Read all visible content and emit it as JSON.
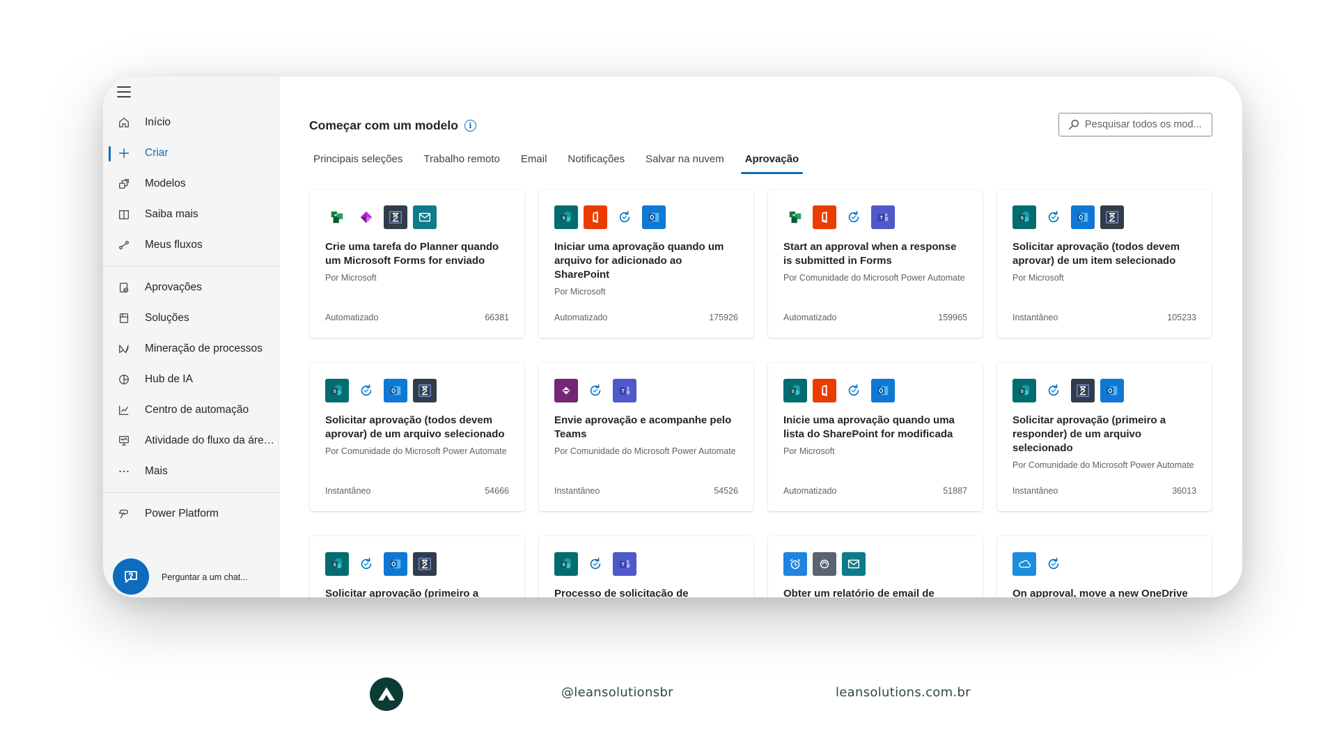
{
  "sidebar": {
    "items": [
      {
        "label": "Início",
        "icon": "home-icon"
      },
      {
        "label": "Criar",
        "icon": "plus-icon",
        "active": true
      },
      {
        "label": "Modelos",
        "icon": "templates-icon"
      },
      {
        "label": "Saiba mais",
        "icon": "book-icon"
      },
      {
        "label": "Meus fluxos",
        "icon": "flows-icon"
      },
      {
        "label": "Aprovações",
        "icon": "approvals-icon"
      },
      {
        "label": "Soluções",
        "icon": "solutions-icon"
      },
      {
        "label": "Mineração de processos",
        "icon": "process-mining-icon"
      },
      {
        "label": "Hub de IA",
        "icon": "ai-hub-icon"
      },
      {
        "label": "Centro de automação",
        "icon": "automation-center-icon"
      },
      {
        "label": "Atividade do fluxo da área...",
        "icon": "desktop-flow-activity-icon"
      },
      {
        "label": "Mais",
        "icon": "more-icon"
      },
      {
        "label": "Power Platform",
        "icon": "power-platform-icon"
      }
    ],
    "chat_label": "Perguntar a um chat..."
  },
  "main": {
    "title": "Começar com um modelo",
    "search_placeholder": "Pesquisar todos os mod...",
    "tabs": [
      {
        "label": "Principais seleções"
      },
      {
        "label": "Trabalho remoto"
      },
      {
        "label": "Email"
      },
      {
        "label": "Notificações"
      },
      {
        "label": "Salvar na nuvem"
      },
      {
        "label": "Aprovação",
        "active": true
      }
    ],
    "cards": [
      {
        "icons": [
          "planner",
          "powerapps",
          "approvals",
          "mail"
        ],
        "title": "Crie uma tarefa do Planner quando um Microsoft Forms for enviado",
        "author": "Por Microsoft",
        "type": "Automatizado",
        "count": "66381"
      },
      {
        "icons": [
          "sharepoint",
          "office",
          "approvals-refresh",
          "outlook"
        ],
        "title": "Iniciar uma aprovação quando um arquivo for adicionado ao SharePoint",
        "author": "Por Microsoft",
        "type": "Automatizado",
        "count": "175926"
      },
      {
        "icons": [
          "planner",
          "office",
          "approvals-refresh",
          "teams"
        ],
        "title": "Start an approval when a response is submitted in Forms",
        "author": "Por Comunidade do Microsoft Power Automate",
        "type": "Automatizado",
        "count": "159965"
      },
      {
        "icons": [
          "sharepoint",
          "approvals-refresh",
          "outlook",
          "approvals"
        ],
        "title": "Solicitar aprovação (todos devem aprovar) de um item selecionado",
        "author": "Por Microsoft",
        "type": "Instantâneo",
        "count": "105233"
      },
      {
        "icons": [
          "sharepoint",
          "approvals-refresh",
          "outlook",
          "approvals"
        ],
        "title": "Solicitar aprovação (todos devem aprovar) de um arquivo selecionado",
        "author": "Por Comunidade do Microsoft Power Automate",
        "type": "Instantâneo",
        "count": "54666"
      },
      {
        "icons": [
          "powerapps-purple",
          "approvals-refresh",
          "teams"
        ],
        "title": "Envie aprovação e acompanhe pelo Teams",
        "author": "Por Comunidade do Microsoft Power Automate",
        "type": "Instantâneo",
        "count": "54526"
      },
      {
        "icons": [
          "sharepoint",
          "office",
          "approvals-refresh",
          "outlook"
        ],
        "title": "Inicie uma aprovação quando uma lista do SharePoint for modificada",
        "author": "Por Microsoft",
        "type": "Automatizado",
        "count": "51887"
      },
      {
        "icons": [
          "sharepoint",
          "approvals-refresh",
          "approvals",
          "outlook"
        ],
        "title": "Solicitar aprovação (primeiro a responder) de um arquivo selecionado",
        "author": "Por Comunidade do Microsoft Power Automate",
        "type": "Instantâneo",
        "count": "36013"
      },
      {
        "icons": [
          "sharepoint",
          "approvals-refresh",
          "outlook",
          "approvals"
        ],
        "title": "Solicitar aprovação (primeiro a",
        "author": "",
        "type": "",
        "count": ""
      },
      {
        "icons": [
          "sharepoint",
          "approvals-refresh",
          "teams"
        ],
        "title": "Processo de solicitação de aprovação",
        "author": "",
        "type": "",
        "count": ""
      },
      {
        "icons": [
          "schedule",
          "gray-circle",
          "mail"
        ],
        "title": "Obter um relatório de email de",
        "author": "",
        "type": "",
        "count": ""
      },
      {
        "icons": [
          "onedrive",
          "approvals-refresh"
        ],
        "title": "On approval, move a new OneDrive",
        "author": "",
        "type": "",
        "count": ""
      }
    ]
  },
  "branding": {
    "handle": "@leansolutionsbr",
    "site": "leansolutions.com.br"
  },
  "colors": {
    "accent": "#0f6cbd",
    "sharepoint": "#036c70",
    "office": "#eb3c00",
    "approvals_dark": "#323c4a",
    "outlook": "#0f78d4",
    "teams": "#5059c9",
    "mail_teal": "#0f7b8a",
    "powerapps_purple": "#742774",
    "brand_dark": "#0d3b36"
  }
}
